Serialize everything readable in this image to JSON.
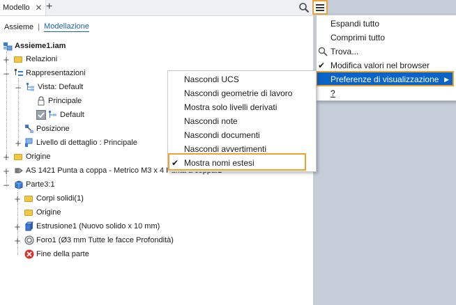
{
  "tab": {
    "label": "Modello"
  },
  "modes": {
    "assembly": "Assieme",
    "modeling": "Modellazione"
  },
  "tree": {
    "root": "Assieme1.iam",
    "relazioni": "Relazioni",
    "rappresentazioni": "Rappresentazioni",
    "vista": "Vista: Default",
    "principale": "Principale",
    "default": "Default",
    "posizione": "Posizione",
    "livello": "Livello di dettaglio : Principale",
    "origine": "Origine",
    "as1421": "AS 1421 Punta a coppa - Metrico M3 x 4 Punta a coppa:1",
    "parte3": "Parte3:1",
    "corpi": "Corpi solidi(1)",
    "origine2": "Origine",
    "estrusione": "Estrusione1 (Nuovo solido x 10 mm)",
    "foro": "Foro1 (Ø3 mm Tutte le facce Profondità)",
    "fine": "Fine della parte"
  },
  "main_menu": {
    "expand_all": "Espandi tutto",
    "collapse_all": "Comprimi tutto",
    "find": "Trova...",
    "modify_values": "Modifica valori nel browser",
    "display_prefs": "Preferenze di visualizzazione",
    "help": "?"
  },
  "sub_menu": {
    "hide_ucs": "Nascondi UCS",
    "hide_work_geom": "Nascondi geometrie di lavoro",
    "show_derived": "Mostra solo livelli derivati",
    "hide_notes": "Nascondi note",
    "hide_docs": "Nascondi documenti",
    "hide_warnings": "Nascondi avvertimenti",
    "show_extended": "Mostra nomi estesi"
  },
  "colors": {
    "accent": "#0a64c8",
    "highlight_border": "#f0a030",
    "viewport": "#c5cdd9"
  }
}
